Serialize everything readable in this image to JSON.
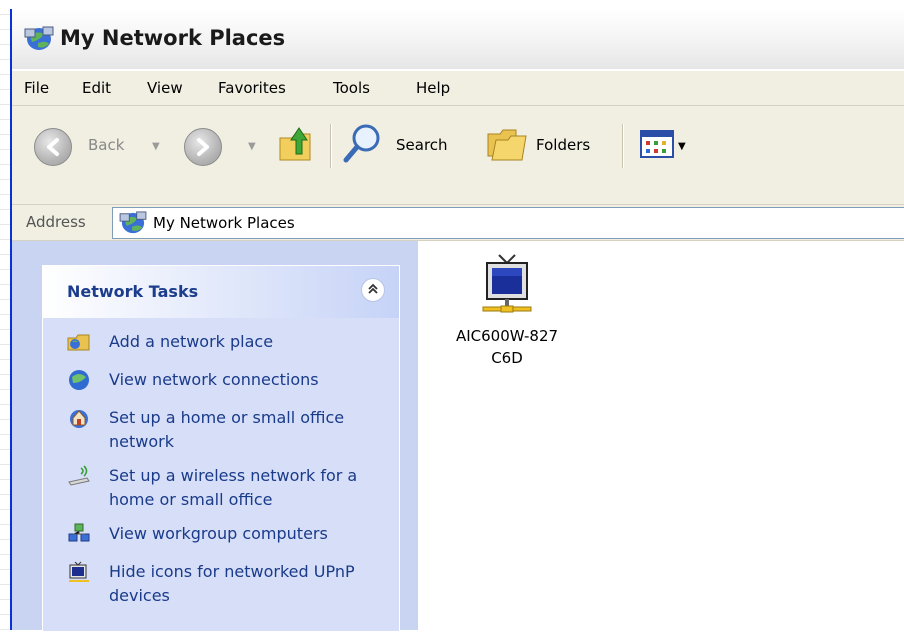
{
  "window": {
    "title": "My Network Places"
  },
  "menu": [
    "File",
    "Edit",
    "View",
    "Favorites",
    "Tools",
    "Help"
  ],
  "toolbar": {
    "back_label": "Back",
    "search_label": "Search",
    "folders_label": "Folders"
  },
  "address": {
    "label": "Address",
    "value": "My Network Places"
  },
  "network_tasks": {
    "title": "Network Tasks",
    "collapse_glyph": "»",
    "items": [
      {
        "label": "Add a network place",
        "icon": "add-network-place-icon"
      },
      {
        "label": "View network connections",
        "icon": "network-connections-icon"
      },
      {
        "label": "Set up a home or small office network",
        "icon": "home-network-icon"
      },
      {
        "label": "Set up a wireless network for a home or small office",
        "icon": "wireless-network-icon"
      },
      {
        "label": "View workgroup computers",
        "icon": "workgroup-icon"
      },
      {
        "label": "Hide icons for networked UPnP devices",
        "icon": "upnp-device-icon"
      }
    ]
  },
  "content": {
    "device": {
      "name_line1": "AIC600W-827",
      "name_line2": "C6D"
    }
  },
  "colors": {
    "window_border": "#0831d9",
    "toolbar_bg": "#f1efe2",
    "task_panel_bg": "#d6dff7",
    "left_pane_bg": "#c8d4f2"
  }
}
